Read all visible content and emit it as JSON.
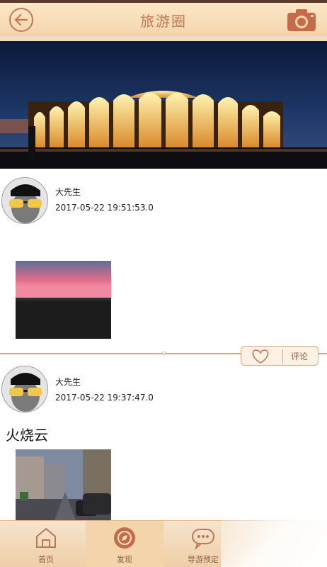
{
  "header": {
    "title": "旅游圈",
    "back_icon": "back-arrow-icon",
    "camera_icon": "camera-icon"
  },
  "posts": [
    {
      "author": "大先生",
      "time": "2017-05-22 19:51:53.0",
      "text": "",
      "actions": {
        "comment_label": "评论"
      }
    },
    {
      "author": "大先生",
      "time": "2017-05-22 19:37:47.0",
      "text": "火烧云"
    }
  ],
  "tabbar": {
    "tabs": [
      {
        "label": "首页",
        "icon": "home-icon"
      },
      {
        "label": "发现",
        "icon": "compass-icon"
      },
      {
        "label": "导游预定",
        "icon": "chat-icon"
      }
    ]
  },
  "colors": {
    "accent": "#c07a56",
    "header_bg": "#fbe7c8",
    "divider": "#d9a888"
  }
}
